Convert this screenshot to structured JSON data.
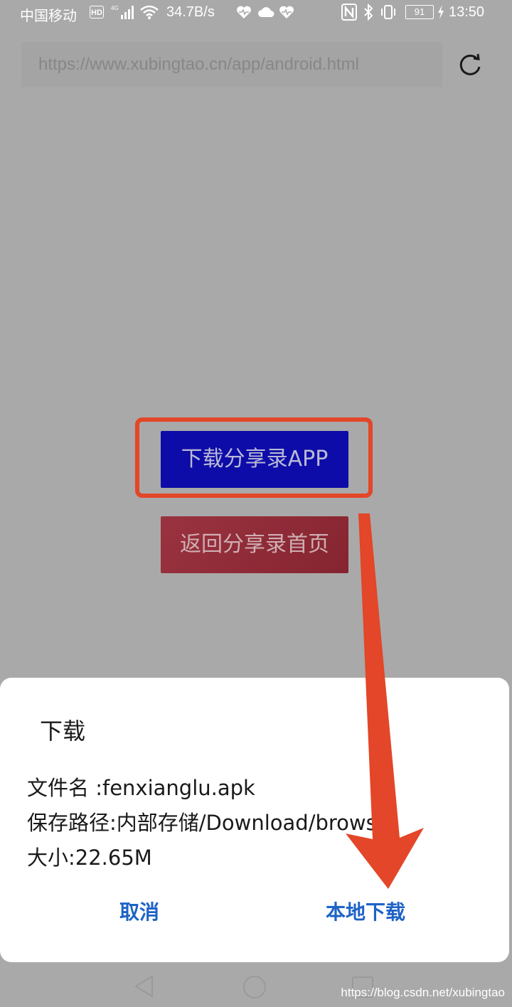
{
  "status_bar": {
    "carrier": "中国移动",
    "hd": "HD",
    "network": "4G",
    "speed": "34.7B/s",
    "battery": "91",
    "time": "13:50"
  },
  "browser": {
    "url": "https://www.xubingtao.cn/app/android.html"
  },
  "page": {
    "download_app_label": "下载分享录APP",
    "back_home_label": "返回分享录首页"
  },
  "dialog": {
    "title": "下载",
    "filename": "文件名 :fenxianglu.apk",
    "save_path": "保存路径:内部存储/Download/brows",
    "size": "大小:22.65M",
    "cancel_label": "取消",
    "download_label": "本地下载"
  },
  "watermark": "https://blog.csdn.net/xubingtao",
  "colors": {
    "accent": "#1e63c5",
    "annotation": "#e34628",
    "download_button": "#0d0ca8",
    "back_button": "#8e2a36"
  }
}
